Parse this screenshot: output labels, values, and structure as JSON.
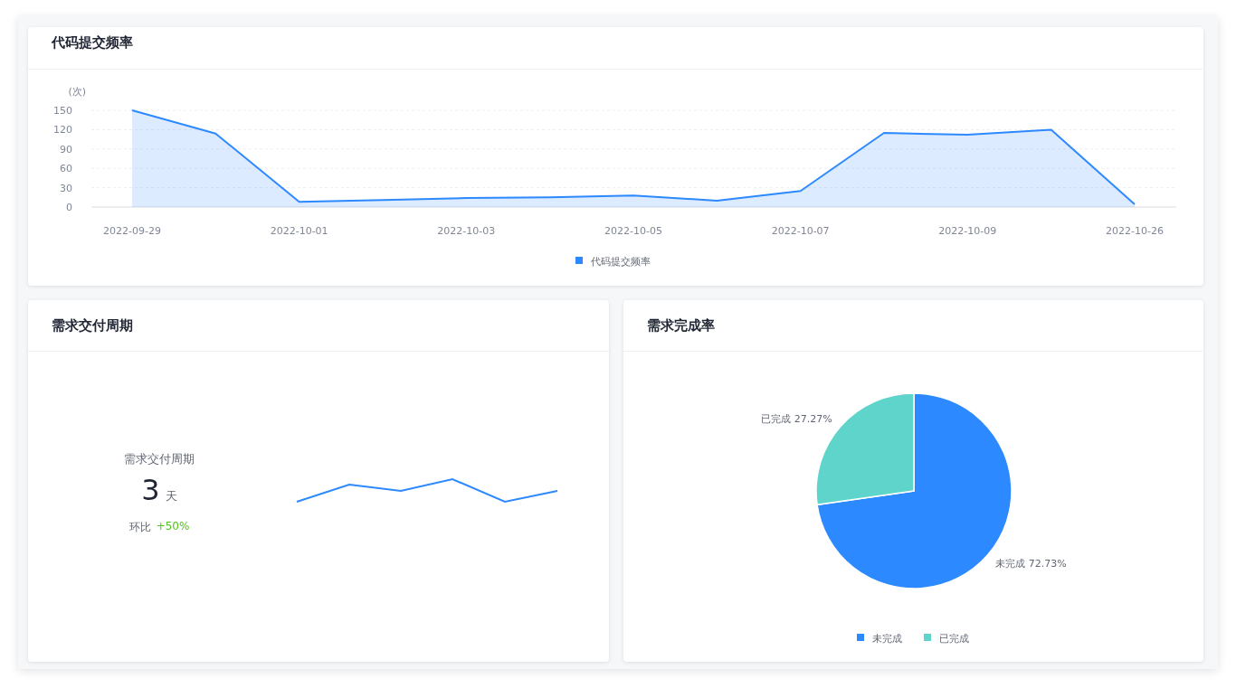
{
  "commit_chart": {
    "title": "代码提交频率",
    "chart_data": {
      "type": "area",
      "ylabel": "(次)",
      "categories": [
        "2022-09-29",
        null,
        "2022-10-01",
        null,
        "2022-10-03",
        null,
        "2022-10-05",
        null,
        "2022-10-07",
        null,
        "2022-10-09",
        null,
        "2022-10-26"
      ],
      "ylim": [
        0,
        150
      ],
      "yticks": [
        0,
        30,
        60,
        90,
        120,
        150
      ],
      "legend": "bottom",
      "grid": true,
      "series": [
        {
          "name": "代码提交频率",
          "color": "#2d89ff",
          "values": [
            150,
            114,
            8,
            11,
            14,
            15,
            18,
            10,
            25,
            115,
            112,
            120,
            4
          ]
        }
      ]
    }
  },
  "delivery_cycle": {
    "title": "需求交付周期",
    "metric_label": "需求交付周期",
    "value": "3",
    "unit": "天",
    "compare_label": "环比",
    "compare_value": "+50%"
  },
  "completion_rate": {
    "title": "需求完成率",
    "chart_data": {
      "type": "pie",
      "categories": [
        "未完成",
        "已完成"
      ],
      "values": [
        72.73,
        27.27
      ],
      "colors": [
        "#2d89ff",
        "#5fd4cb"
      ],
      "value_labels": [
        "72.73%",
        "27.27%"
      ],
      "legend": "bottom"
    },
    "legend": [
      "未完成",
      "已完成"
    ]
  }
}
